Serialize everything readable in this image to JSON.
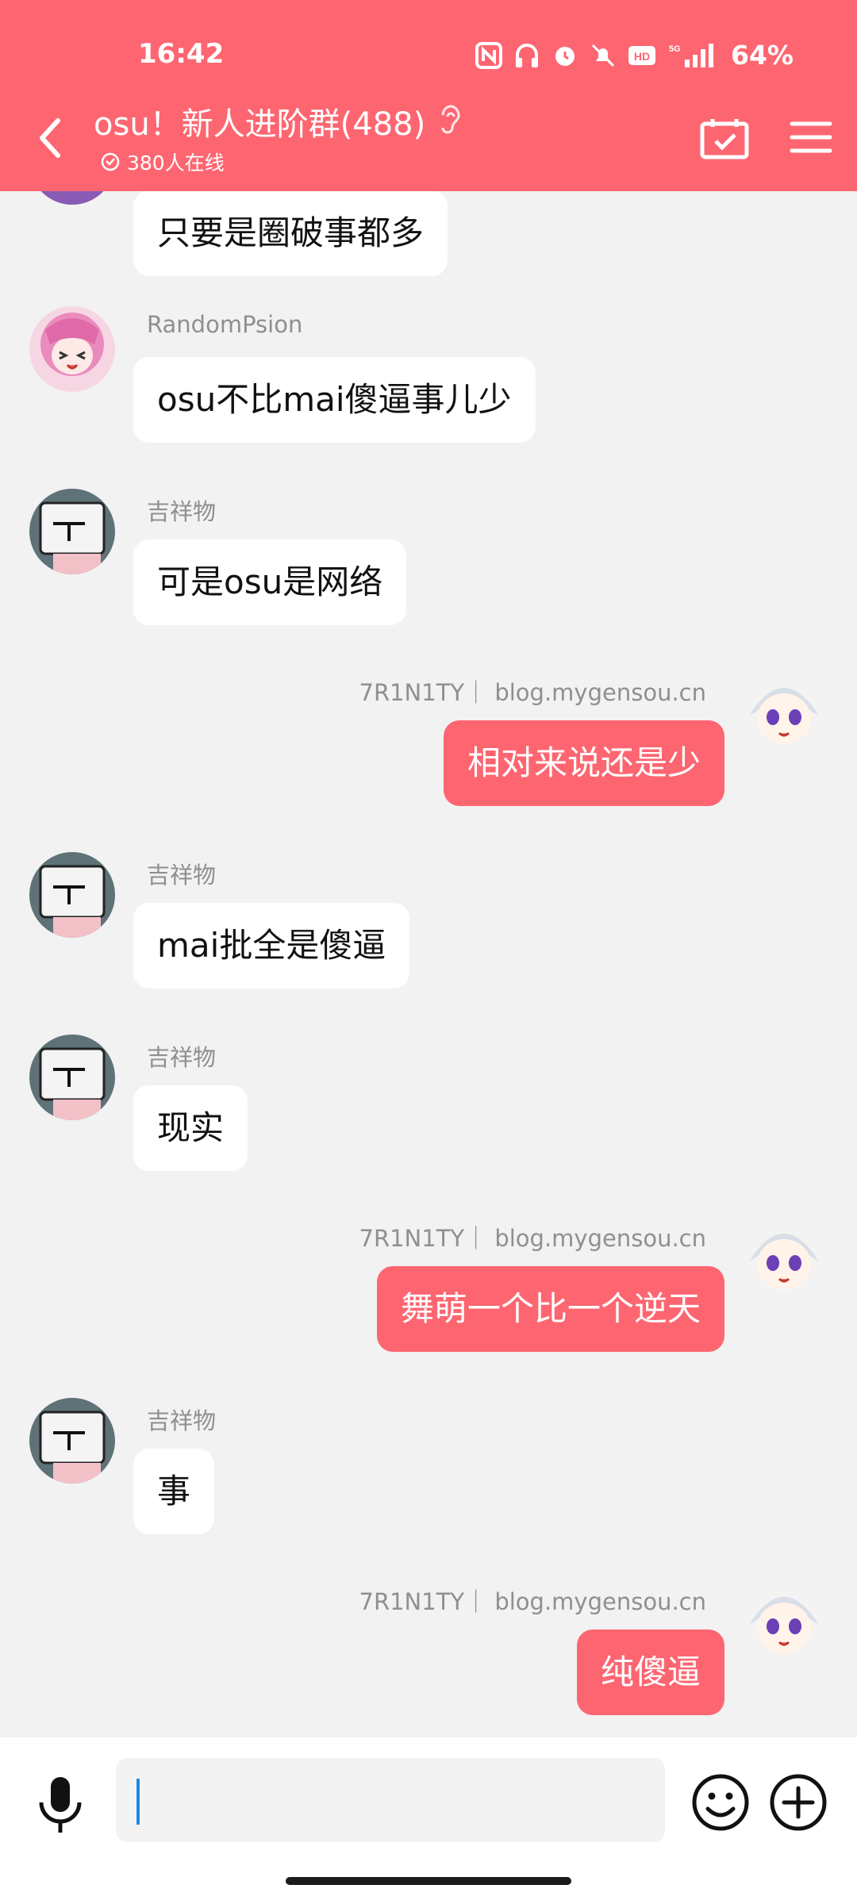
{
  "status_bar": {
    "time": "16:42",
    "battery": "64%",
    "icons": [
      "nfc-icon",
      "headphones-icon",
      "alarm-icon",
      "mute-icon",
      "hd-icon",
      "5g-signal-icon"
    ]
  },
  "header": {
    "title": "osu！新人进阶群(488)",
    "online": "380人在线",
    "background": "#fd6671"
  },
  "messages": [
    {
      "side": "left",
      "sender": "",
      "text": "只要是圈破事都多",
      "avatar": "purple"
    },
    {
      "side": "left",
      "sender": "RandomPsion",
      "text": "osu不比mai傻逼事儿少",
      "avatar": "pink-girl"
    },
    {
      "side": "left",
      "sender": "吉祥物",
      "text": "可是osu是网络",
      "avatar": "mascot"
    },
    {
      "side": "right",
      "sender": "7R1N1TY｜ blog.mygensou.cn",
      "text": "相对来说还是少",
      "avatar": "silver-girl"
    },
    {
      "side": "left",
      "sender": "吉祥物",
      "text": "mai批全是傻逼",
      "avatar": "mascot"
    },
    {
      "side": "left",
      "sender": "吉祥物",
      "text": "现实",
      "avatar": "mascot"
    },
    {
      "side": "right",
      "sender": "7R1N1TY｜ blog.mygensou.cn",
      "text": "舞萌一个比一个逆天",
      "avatar": "silver-girl"
    },
    {
      "side": "left",
      "sender": "吉祥物",
      "text": "事",
      "avatar": "mascot"
    },
    {
      "side": "right",
      "sender": "7R1N1TY｜ blog.mygensou.cn",
      "text": "纯傻逼",
      "avatar": "silver-girl"
    }
  ],
  "input_bar": {
    "value": "",
    "placeholder": ""
  }
}
